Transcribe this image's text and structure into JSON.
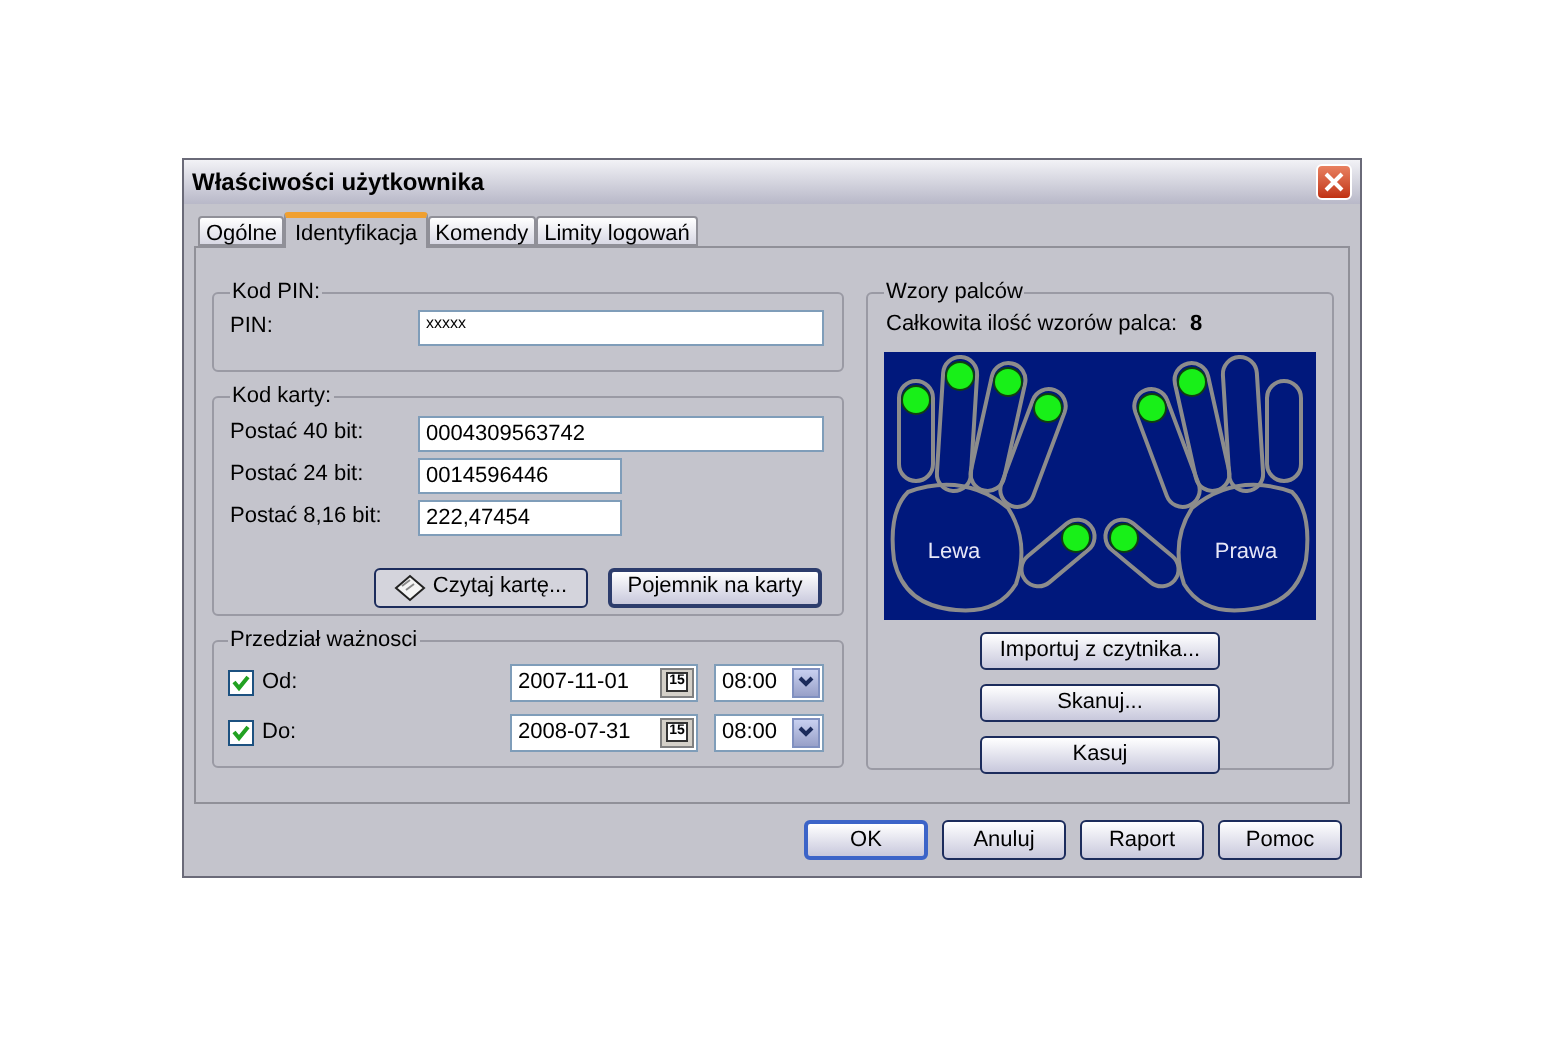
{
  "window": {
    "title": "Właściwości użytkownika"
  },
  "tabs": [
    {
      "label": "Ogólne",
      "selected": false
    },
    {
      "label": "Identyfikacja",
      "selected": true
    },
    {
      "label": "Komendy",
      "selected": false
    },
    {
      "label": "Limity logowań",
      "selected": false
    }
  ],
  "pin_group": {
    "title": "Kod PIN:",
    "label": "PIN:",
    "value": "xxxxx"
  },
  "card_group": {
    "title": "Kod karty:",
    "fields": [
      {
        "label": "Postać 40 bit:",
        "value": "0004309563742"
      },
      {
        "label": "Postać 24 bit:",
        "value": "0014596446"
      },
      {
        "label": "Postać 8,16 bit:",
        "value": "222,47454"
      }
    ],
    "buttons": [
      {
        "label": "Czytaj kartę...",
        "kind": "icon",
        "default": false
      },
      {
        "label": "Pojemnik na karty",
        "kind": "plain",
        "default": true
      }
    ]
  },
  "validity_group": {
    "title": "Przedział ważnosci",
    "rows": [
      {
        "label": "Od:",
        "checked": true,
        "date": "2007-11-01",
        "calendar_day": "15",
        "time": "08:00"
      },
      {
        "label": "Do:",
        "checked": true,
        "date": "2008-07-31",
        "calendar_day": "15",
        "time": "08:00"
      }
    ]
  },
  "fingerprints": {
    "title": "Wzory palców",
    "count_label": "Całkowita ilość wzorów palca:",
    "count": "8",
    "left_label": "Lewa",
    "right_label": "Prawa",
    "fingers": [
      {
        "enrolled": true
      },
      {
        "enrolled": true
      },
      {
        "enrolled": true
      },
      {
        "enrolled": true
      },
      {
        "enrolled": true
      },
      {
        "enrolled": true
      },
      {
        "enrolled": true
      },
      {
        "enrolled": true
      },
      {
        "enrolled": false
      },
      {
        "enrolled": false
      }
    ],
    "buttons": [
      {
        "label": "Importuj z czytnika..."
      },
      {
        "label": "Skanuj..."
      },
      {
        "label": "Kasuj"
      }
    ]
  },
  "dialog_buttons": [
    {
      "label": "OK",
      "default": true
    },
    {
      "label": "Anuluj",
      "default": false
    },
    {
      "label": "Raport",
      "default": false
    },
    {
      "label": "Pomoc",
      "default": false
    }
  ]
}
